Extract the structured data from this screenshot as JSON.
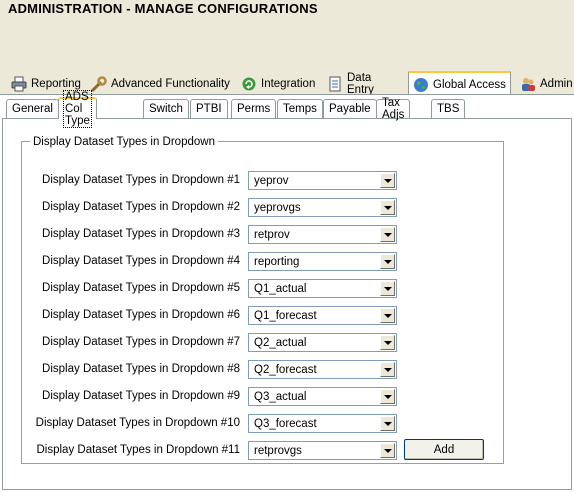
{
  "page": {
    "title": "ADMINISTRATION - MANAGE CONFIGURATIONS"
  },
  "top_tabs": [
    {
      "label": "Reporting",
      "icon": "printer-icon"
    },
    {
      "label": "Advanced Functionality",
      "icon": "wrench-icon"
    },
    {
      "label": "Integration",
      "icon": "refresh-icon"
    },
    {
      "label": "Data Entry",
      "icon": "document-icon"
    },
    {
      "label": "Global Access",
      "icon": "globe-icon"
    },
    {
      "label": "Admin",
      "icon": "users-icon"
    }
  ],
  "active_top_tab": "Global Access",
  "sub_tabs": [
    "General",
    "ADS Col Type",
    "Switch",
    "PTBI",
    "Perms",
    "Temps",
    "Payable",
    "Tax Adjs",
    "TBS"
  ],
  "active_sub_tab": "ADS Col Type",
  "group": {
    "legend": "Display Dataset Types in Dropdown",
    "rows": [
      {
        "label": "Display Dataset Types in Dropdown #1",
        "value": "yeprov"
      },
      {
        "label": "Display Dataset Types in Dropdown #2",
        "value": "yeprovgs"
      },
      {
        "label": "Display Dataset Types in Dropdown #3",
        "value": "retprov"
      },
      {
        "label": "Display Dataset Types in Dropdown #4",
        "value": "reporting"
      },
      {
        "label": "Display Dataset Types in Dropdown #5",
        "value": "Q1_actual"
      },
      {
        "label": "Display Dataset Types in Dropdown #6",
        "value": "Q1_forecast"
      },
      {
        "label": "Display Dataset Types in Dropdown #7",
        "value": "Q2_actual"
      },
      {
        "label": "Display Dataset Types in Dropdown #8",
        "value": "Q2_forecast"
      },
      {
        "label": "Display Dataset Types in Dropdown #9",
        "value": "Q3_actual"
      },
      {
        "label": "Display Dataset Types in Dropdown #10",
        "value": "Q3_forecast"
      },
      {
        "label": "Display Dataset Types in Dropdown #11",
        "value": "retprovgs"
      }
    ],
    "add_label": "Add"
  },
  "colors": {
    "active_tab_accent": "#ffc83c",
    "panel_bg": "#ffffff",
    "window_bg": "#ece9d8",
    "group_border": "#7fa7b5"
  }
}
